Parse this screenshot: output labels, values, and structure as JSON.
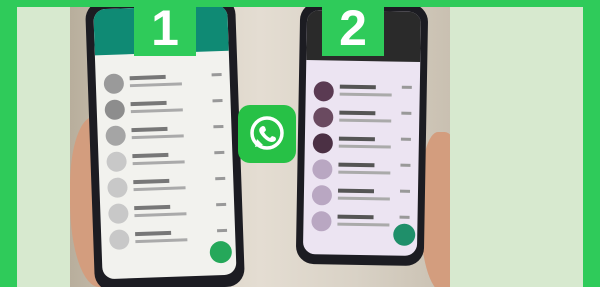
{
  "badges": {
    "left": "1",
    "right": "2"
  },
  "colors": {
    "brand_green": "#2fcb5a",
    "panel": "#d7e9cf",
    "whatsapp": "#27c146"
  },
  "icons": {
    "center": "whatsapp-logo-icon"
  }
}
